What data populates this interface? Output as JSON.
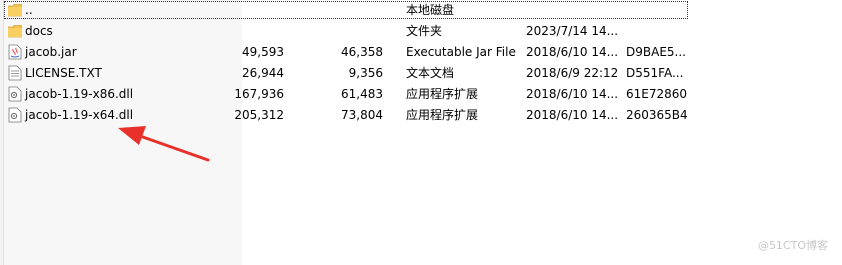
{
  "files": [
    {
      "icon": "folder-up-icon",
      "name": "..",
      "packed": "",
      "size": "",
      "type": "本地磁盘",
      "date": "",
      "crc": ""
    },
    {
      "icon": "folder-icon",
      "name": "docs",
      "packed": "",
      "size": "",
      "type": "文件夹",
      "date": "2023/7/14 14...",
      "crc": ""
    },
    {
      "icon": "jar-file-icon",
      "name": "jacob.jar",
      "packed": "49,593",
      "size": "46,358",
      "type": "Executable Jar File",
      "date": "2018/6/10 14...",
      "crc": "D9BAE5..."
    },
    {
      "icon": "text-file-icon",
      "name": "LICENSE.TXT",
      "packed": "26,944",
      "size": "9,356",
      "type": "文本文档",
      "date": "2018/6/9 22:12",
      "crc": "D551FA..."
    },
    {
      "icon": "dll-file-icon",
      "name": "jacob-1.19-x86.dll",
      "packed": "167,936",
      "size": "61,483",
      "type": "应用程序扩展",
      "date": "2018/6/10 14...",
      "crc": "61E72860"
    },
    {
      "icon": "dll-file-icon",
      "name": "jacob-1.19-x64.dll",
      "packed": "205,312",
      "size": "73,804",
      "type": "应用程序扩展",
      "date": "2018/6/10 14...",
      "crc": "260365B4"
    }
  ],
  "annotation": {
    "arrow_color": "#e8312a",
    "icon": "red-arrow-annotation"
  },
  "colors": {
    "folder": "#f2c14e",
    "folder_dark": "#d9a53a",
    "selection_border": "#333333"
  },
  "watermark": "@51CTO博客"
}
